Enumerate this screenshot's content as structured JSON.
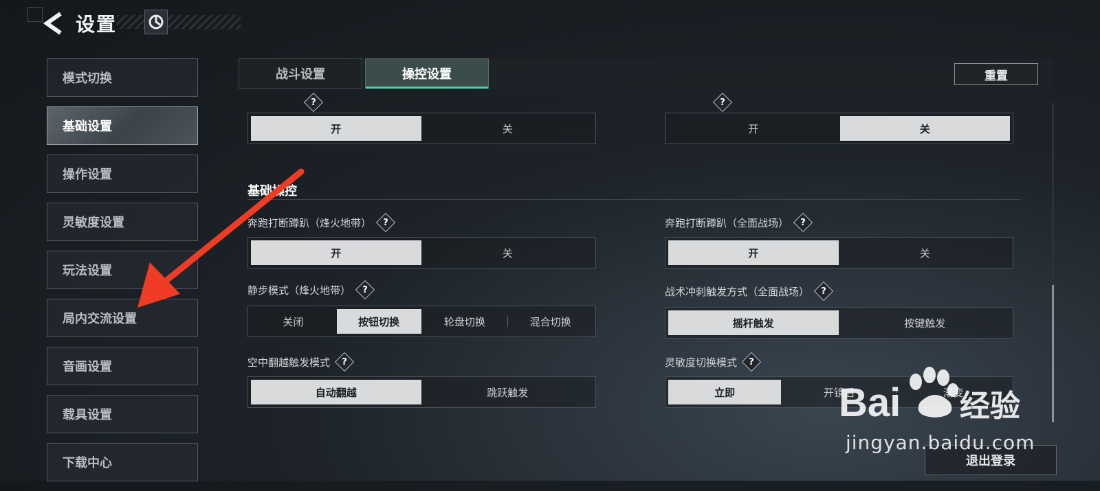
{
  "header": {
    "title": "设置"
  },
  "sidebar": {
    "items": [
      {
        "label": "模式切换",
        "active": false
      },
      {
        "label": "基础设置",
        "active": true
      },
      {
        "label": "操作设置",
        "active": false
      },
      {
        "label": "灵敏度设置",
        "active": false
      },
      {
        "label": "玩法设置",
        "active": false
      },
      {
        "label": "局内交流设置",
        "active": false
      },
      {
        "label": "音画设置",
        "active": false
      },
      {
        "label": "载具设置",
        "active": false
      },
      {
        "label": "下载中心",
        "active": false
      }
    ]
  },
  "tabs": [
    {
      "label": "战斗设置",
      "active": false
    },
    {
      "label": "操控设置",
      "active": true
    }
  ],
  "reset_label": "重置",
  "top_toggles": {
    "left": {
      "options": [
        "开",
        "关"
      ],
      "selected": 0
    },
    "right": {
      "options": [
        "开",
        "关"
      ],
      "selected": 1
    }
  },
  "section": {
    "title": "基础操控"
  },
  "settings": [
    {
      "label": "奔跑打断蹲趴（烽火地带）",
      "options": [
        "开",
        "关"
      ],
      "selected": 0
    },
    {
      "label": "奔跑打断蹲趴（全面战场）",
      "options": [
        "开",
        "关"
      ],
      "selected": 0
    },
    {
      "label": "静步模式（烽火地带）",
      "options": [
        "关闭",
        "按钮切换",
        "轮盘切换",
        "混合切换"
      ],
      "selected": 1
    },
    {
      "label": "战术冲刺触发方式（全面战场）",
      "options": [
        "摇杆触发",
        "按键触发"
      ],
      "selected": 0
    },
    {
      "label": "空中翻越触发模式",
      "options": [
        "自动翻越",
        "跳跃触发"
      ],
      "selected": 0
    },
    {
      "label": "灵敏度切换模式",
      "options": [
        "立即",
        "开镜后",
        "渐变"
      ],
      "selected": 0
    }
  ],
  "help_glyph": "?",
  "logout_label": "退出登录",
  "watermark": {
    "brand": "Bai",
    "brand2": "经验",
    "url": "jingyan.baidu.com"
  },
  "colors": {
    "accent": "#3fd3a0",
    "selected": "#d8dadb",
    "arrow": "#f03c24"
  }
}
